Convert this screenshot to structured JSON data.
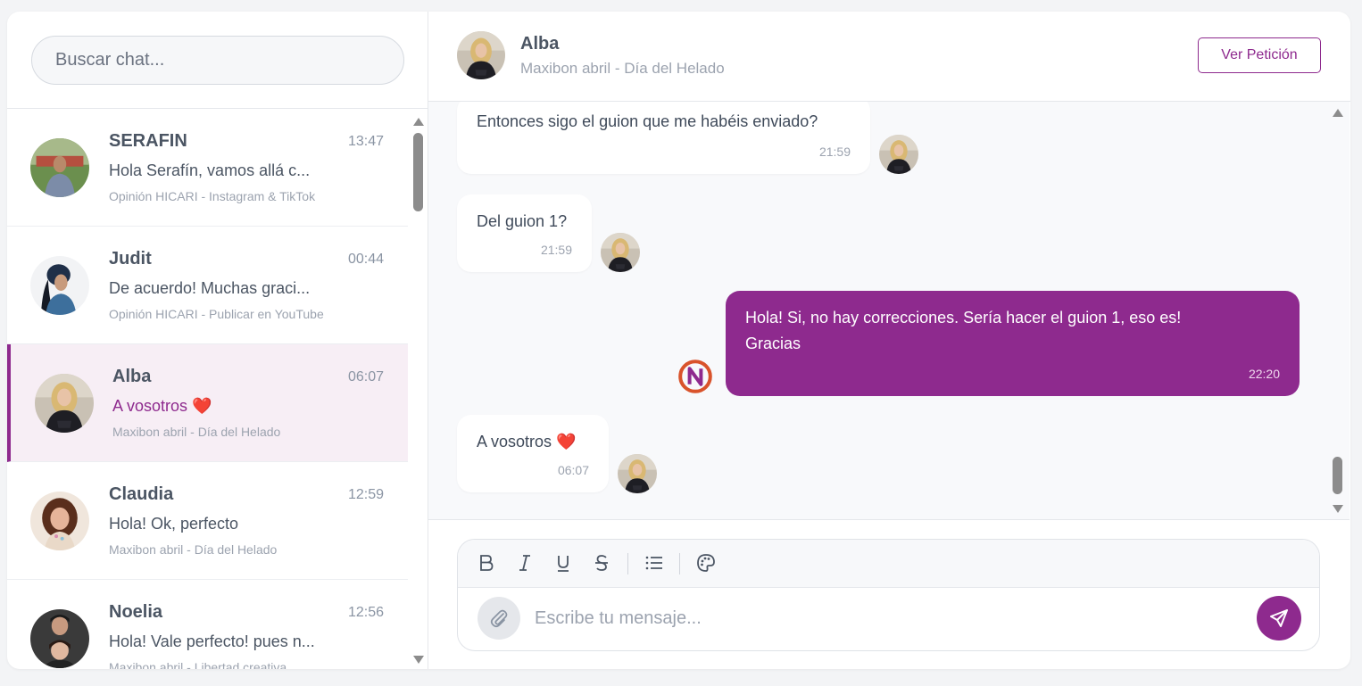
{
  "colors": {
    "accent": "#8e2a8e",
    "active_row_bg": "#f7eef5",
    "messages_bg": "#f8f9fb"
  },
  "search": {
    "placeholder": "Buscar chat..."
  },
  "chats": [
    {
      "name": "SERAFIN",
      "time": "13:47",
      "preview": "Hola Serafín, vamos allá c...",
      "meta": "Opinión HICARI - Instagram & TikTok",
      "avatar": "serafin-avatar"
    },
    {
      "name": "Judit",
      "time": "00:44",
      "preview": "De acuerdo! Muchas graci...",
      "meta": "Opinión HICARI - Publicar en YouTube",
      "avatar": "judit-avatar"
    },
    {
      "name": "Alba",
      "time": "06:07",
      "preview": "A vosotros ❤️",
      "meta": "Maxibon abril - Día del Helado",
      "avatar": "alba-avatar",
      "active": true
    },
    {
      "name": "Claudia",
      "time": "12:59",
      "preview": "Hola! Ok, perfecto",
      "meta": "Maxibon abril - Día del Helado",
      "avatar": "claudia-avatar"
    },
    {
      "name": "Noelia",
      "time": "12:56",
      "preview": "Hola! Vale perfecto! pues n...",
      "meta": "Maxibon abril - Libertad creativa",
      "avatar": "noelia-avatar"
    }
  ],
  "header": {
    "name": "Alba",
    "subtitle": "Maxibon abril - Día del Helado",
    "ver_peticion": "Ver Petición"
  },
  "messages": [
    {
      "dir": "in",
      "text": "Entonces sigo el guion que me habéis enviado?",
      "time": "21:59"
    },
    {
      "dir": "in",
      "text": "Del guion 1?",
      "time": "21:59"
    },
    {
      "dir": "out",
      "text_line1": "Hola! Si, no hay correcciones. Sería hacer el guion 1, eso es!",
      "text_line2": "Gracias",
      "time": "22:20"
    },
    {
      "dir": "in",
      "text": "A vosotros ❤️",
      "time": "06:07"
    }
  ],
  "composer": {
    "placeholder": "Escribe tu mensaje...",
    "toolbar_icons": [
      "bold-icon",
      "italic-icon",
      "underline-icon",
      "strikethrough-icon",
      "list-icon",
      "palette-icon"
    ]
  }
}
